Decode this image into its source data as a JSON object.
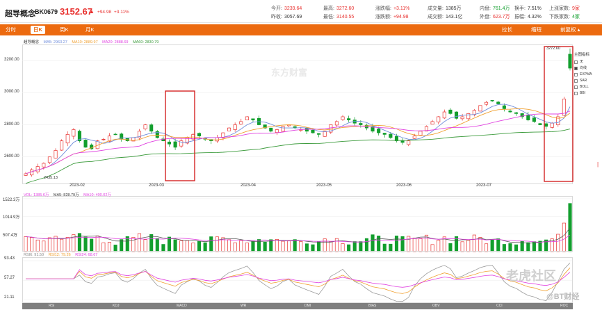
{
  "header": {
    "name": "超导概念",
    "code": "BK0679",
    "price": "3152.67",
    "arrow": "▲",
    "change": "+94.98",
    "change_pct": "+3.11%",
    "stats": [
      {
        "k": "今开:",
        "v": "3239.64",
        "c": "red"
      },
      {
        "k": "昨收:",
        "v": "3057.69",
        "c": ""
      },
      {
        "k": "最高:",
        "v": "3272.60",
        "c": "red"
      },
      {
        "k": "最低:",
        "v": "3140.55",
        "c": "red"
      },
      {
        "k": "涨跌幅:",
        "v": "+3.11%",
        "c": "red"
      },
      {
        "k": "涨跌额:",
        "v": "+94.98",
        "c": "red"
      },
      {
        "k": "成交量:",
        "v": "1385万",
        "c": ""
      },
      {
        "k": "成交额:",
        "v": "143.1亿",
        "c": ""
      },
      {
        "k": "内盘:",
        "v": "761.4万",
        "c": "grn"
      },
      {
        "k": "外盘:",
        "v": "623.7万",
        "c": "red"
      },
      {
        "k": "换手:",
        "v": "7.51%",
        "c": ""
      },
      {
        "k": "振幅:",
        "v": "4.32%",
        "c": ""
      },
      {
        "k": "上涨家数:",
        "v": "9家",
        "c": "red"
      },
      {
        "k": "下跌家数:",
        "v": "4家",
        "c": "grn"
      }
    ]
  },
  "tabs": [
    "分时",
    "日K",
    "周K",
    "月K"
  ],
  "active_tab": "日K",
  "right_tabs": [
    "拉长",
    "缩短",
    "前复权 ▴"
  ],
  "main_legend": {
    "name": "超导概念",
    "ma5": "MA5: 2963.27",
    "ma10": "MA10: 2889.97",
    "ma20": "MA20: 2888.69",
    "ma60": "MA60: 2830.79"
  },
  "main_axis": {
    "labels": [
      "3200.00",
      "3000.00",
      "2800.00",
      "2600.00"
    ],
    "values": [
      3200,
      3000,
      2800,
      2600
    ],
    "ymin": 2430,
    "ymax": 3300
  },
  "dates": [
    "2023-02",
    "2023-03",
    "2023-04",
    "2023-05",
    "2023-06",
    "2023-07"
  ],
  "annotations": {
    "high": "3272.60",
    "low": "2435.13"
  },
  "indicator_panel": {
    "title": "主图指标",
    "items": [
      {
        "label": "无",
        "on": false
      },
      {
        "label": "均线",
        "on": true
      },
      {
        "label": "EXPMA",
        "on": false
      },
      {
        "label": "SAR",
        "on": false
      },
      {
        "label": "BOLL",
        "on": false
      },
      {
        "label": "BBI",
        "on": false
      }
    ]
  },
  "vol_legend": {
    "vol": "VOL: 1385.6万",
    "ma5": "MA5: 828.79万",
    "ma10": "MA10: 400.02万"
  },
  "vol_axis": {
    "labels": [
      "1522.3万",
      "1014.9万",
      "507.4万"
    ],
    "values": [
      1522.3,
      1014.9,
      507.4
    ],
    "max": 1600
  },
  "rsi_legend": {
    "rsi6": "RSI6: 91.50",
    "rsi12": "RSI12: 79.26",
    "rsi24": "RSI24: 68.67"
  },
  "rsi_axis": {
    "labels": [
      "93.43",
      "57.27",
      "21.11"
    ],
    "values": [
      93.43,
      57.27,
      21.11
    ]
  },
  "bottom_tools": [
    "RSI",
    "KDJ",
    "MACD",
    "WR",
    "DMI",
    "BIAS",
    "OBV",
    "CCI",
    "ROC"
  ],
  "watermarks": {
    "top": "东方财富",
    "brand": "老虎社区",
    "handle": "@BT财经"
  },
  "colors": {
    "up": "#e8312f",
    "down": "#129e2d",
    "ma5": "#6f8ddb",
    "ma10": "#f0a030",
    "ma20": "#e040e0",
    "ma60": "#3a9a3a",
    "brand": "#ec6a0f",
    "box": "#d42323"
  },
  "chart_data": {
    "type": "candlestick",
    "title": "超导概念",
    "approx_closes": [
      2495,
      2520,
      2540,
      2560,
      2600,
      2640,
      2700,
      2740,
      2770,
      2700,
      2660,
      2650,
      2700,
      2710,
      2730,
      2740,
      2710,
      2700,
      2720,
      2760,
      2800,
      2760,
      2720,
      2700,
      2680,
      2660,
      2700,
      2720,
      2740,
      2730,
      2710,
      2700,
      2720,
      2750,
      2780,
      2800,
      2820,
      2850,
      2830,
      2800,
      2780,
      2760,
      2770,
      2790,
      2800,
      2780,
      2770,
      2760,
      2750,
      2740,
      2760,
      2800,
      2820,
      2850,
      2830,
      2810,
      2800,
      2780,
      2760,
      2750,
      2740,
      2720,
      2700,
      2690,
      2700,
      2730,
      2760,
      2790,
      2820,
      2850,
      2880,
      2870,
      2840,
      2850,
      2870,
      2890,
      2920,
      2940,
      2950,
      2930,
      2900,
      2880,
      2870,
      2850,
      2830,
      2820,
      2800,
      2790,
      2810,
      2850,
      2960,
      3152.67
    ]
  }
}
